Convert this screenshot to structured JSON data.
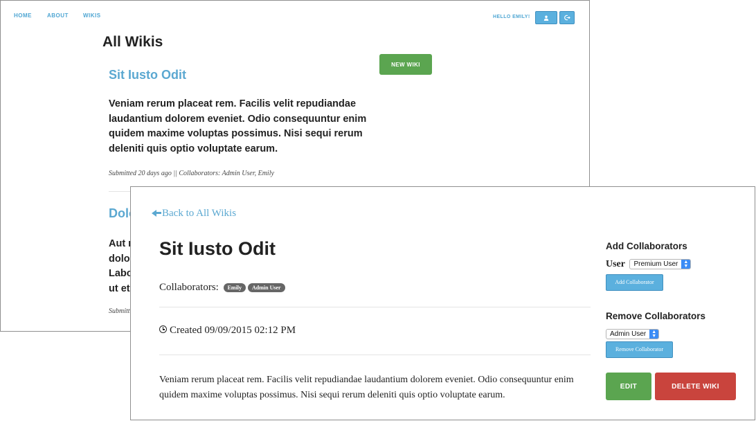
{
  "back_window": {
    "nav": {
      "home": "HOME",
      "about": "ABOUT",
      "wikis": "WIKIS"
    },
    "greeting": "HELLO EMILY!",
    "user_button_icon": "user-icon",
    "signout_button_icon": "sign-out-icon",
    "page_title": "All Wikis",
    "new_wiki_label": "NEW WIKI",
    "wikis": [
      {
        "title": "Sit Iusto Odit",
        "excerpt": "Veniam rerum placeat rem. Facilis velit repudiandae laudantium dolorem eveniet. Odio consequuntur enim quidem maxime voluptas possimus. Nisi sequi rerum deleniti quis optio voluptate earum.",
        "meta": "Submitted 20 days ago || Collaborators: Admin User, Emily"
      },
      {
        "title_partial": "Dolo",
        "excerpt_lines": [
          "Aut r",
          "dolor",
          "Labo",
          "ut et"
        ],
        "meta_partial": "Submitt"
      }
    ]
  },
  "front_window": {
    "back_link": "Back to All Wikis",
    "wiki_title": "Sit Iusto Odit",
    "collaborators_label": "Collaborators:",
    "collaborators": [
      "Emily",
      "Admin User"
    ],
    "created": "Created 09/09/2015 02:12 PM",
    "body": "Veniam rerum placeat rem. Facilis velit repudiandae laudantium dolorem eveniet. Odio consequuntur enim quidem maxime voluptas possimus. Nisi sequi rerum deleniti quis optio voluptate earum.",
    "add_collaborators": {
      "heading": "Add Collaborators",
      "user_label": "User",
      "selected": "Premium User",
      "button": "Add Collaborator"
    },
    "remove_collaborators": {
      "heading": "Remove Collaborators",
      "selected": "Admin User",
      "button": "Remove Collaborator"
    },
    "edit_label": "EDIT",
    "delete_label": "DELETE WIKI"
  },
  "colors": {
    "link_blue": "#5ba8d1",
    "button_blue": "#5bb0de",
    "green": "#5ba550",
    "red": "#c9443d"
  }
}
